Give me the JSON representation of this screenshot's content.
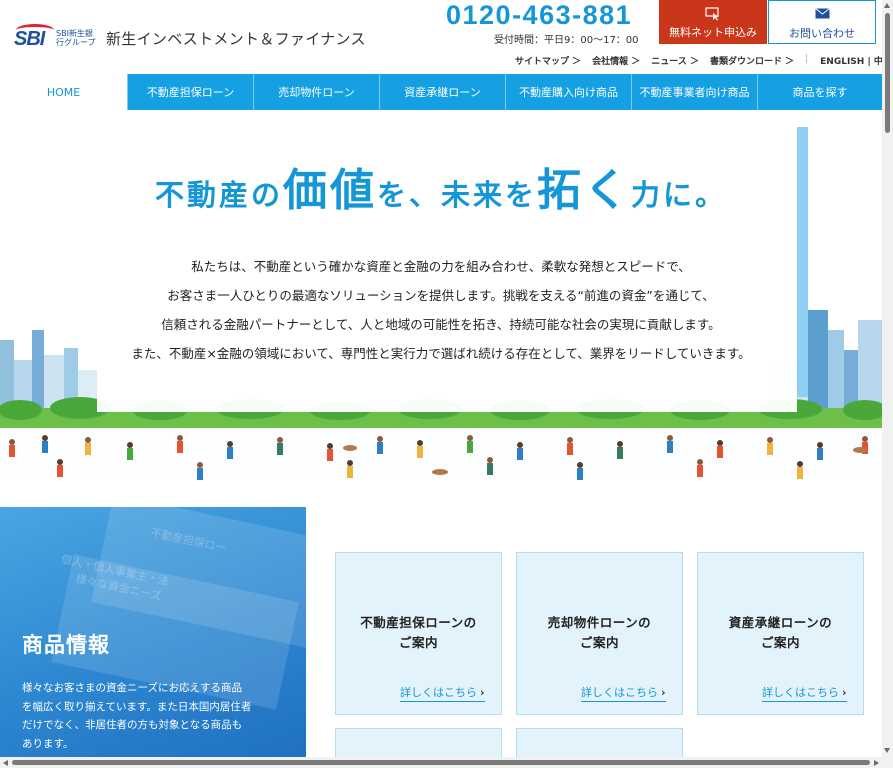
{
  "header": {
    "logo_mark": "SBI",
    "logo_group": "SBI新生銀行グループ",
    "company_name": "新生インベストメント＆ファイナンス",
    "tel": "0120-463-881",
    "hours": "受付時間：平日9：00〜17：00",
    "apply_label": "無料ネット申込み",
    "contact_label": "お問い合わせ",
    "apply_icon": "click-hand-icon",
    "contact_icon": "envelope-icon",
    "util_links": [
      "サイトマップ ＞",
      "会社情報 ＞",
      "ニュース ＞",
      "書類ダウンロード ＞"
    ],
    "lang_links": "ENGLISH | 中文"
  },
  "nav": {
    "items": [
      "HOME",
      "不動産担保ローン",
      "売却物件ローン",
      "資産承継ローン",
      "不動産購入向け商品",
      "不動産事業者向け商品",
      "商品を探す"
    ]
  },
  "hero": {
    "catch_parts": [
      "不動産の",
      "価値",
      "を、未来を",
      "拓く",
      "力に。"
    ],
    "lead_lines": [
      "私たちは、不動産という確かな資産と金融の力を組み合わせ、柔軟な発想とスピードで、",
      "お客さま一人ひとりの最適なソリューションを提供します。挑戦を支える“前進の資金”を通じて、",
      "信頼される金融パートナーとして、人と地域の可能性を拓き、持続可能な社会の実現に貢献します。",
      "また、不動産×金融の領域において、専門性と実行力で選ばれ続ける存在として、業界をリードしていきます。"
    ]
  },
  "products": {
    "title": "商品情報",
    "description": "様々なお客さまの資金ニーズにお応えする商品を幅広く取り揃えています。また日本国内居住者だけでなく、非居住者の方も対象となる商品もあります。",
    "deco_texts": [
      "不動産担保ロー",
      "個人・個人事業主・法",
      "様々な資金ニーズ"
    ],
    "cards": [
      {
        "line1": "不動産担保ローンの",
        "line2": "ご案内",
        "link": "詳しくはこちら"
      },
      {
        "line1": "売却物件ローンの",
        "line2": "ご案内",
        "link": "詳しくはこちら"
      },
      {
        "line1": "資産承継ローンの",
        "line2": "ご案内",
        "link": "詳しくはこちら"
      }
    ]
  },
  "colors": {
    "brand_blue": "#1496d7",
    "nav_blue": "#14a0e3",
    "apply_red": "#c9361a",
    "card_bg": "#e3f3fb"
  }
}
